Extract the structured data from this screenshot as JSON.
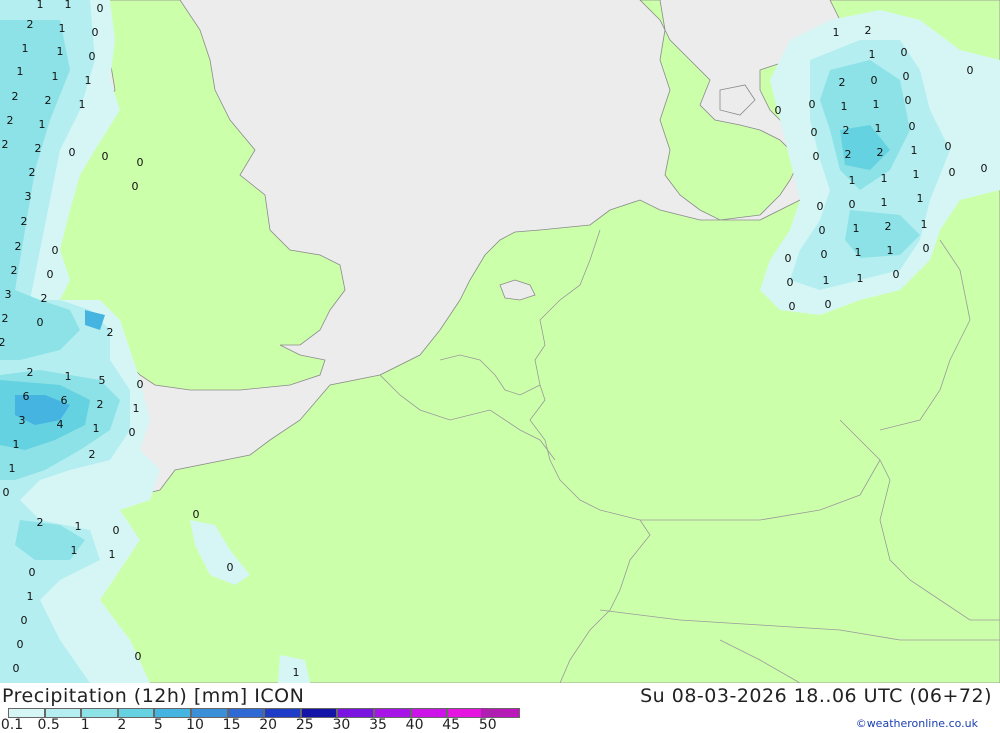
{
  "title": "Precipitation (12h) [mm] ICON",
  "datetime": "Su 08-03-2026 18..06 UTC (06+72)",
  "credit": "©weatheronline.co.uk",
  "colors": {
    "sea": "#ececec",
    "land": "#ccffaa",
    "border": "#a0a0a0",
    "coast": "#8a8a8a"
  },
  "legend": {
    "colors": [
      "#d6f6f6",
      "#b4eef0",
      "#8ce2e6",
      "#64d2e0",
      "#46b4e0",
      "#3a8fd8",
      "#2f6ad4",
      "#1e3cc8",
      "#1414a8",
      "#7a14e0",
      "#a614e8",
      "#cc14e8",
      "#e614e0",
      "#c014c0"
    ],
    "labels": [
      "0.1",
      "0.5",
      "1",
      "2",
      "5",
      "10",
      "15",
      "20",
      "25",
      "30",
      "35",
      "40",
      "45",
      "50"
    ]
  },
  "map_values": [
    "0",
    "1",
    "2",
    "3",
    "4",
    "5",
    "6"
  ]
}
